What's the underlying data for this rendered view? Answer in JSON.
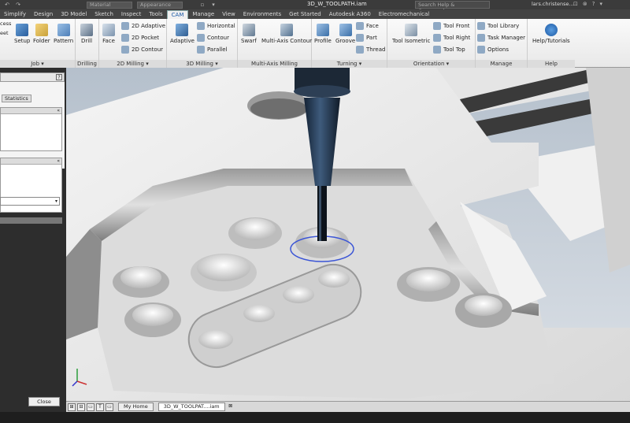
{
  "titlebar": {
    "qa_icons": [
      "↶",
      "↷",
      "▫",
      "▾"
    ],
    "material_combo": "Material",
    "appearance_combo": "Appearance",
    "document_title": "3D_W_TOOLPATH.iam",
    "search_placeholder": "Search Help & Commands...",
    "user_name": "lars.christense...",
    "right_icons": [
      "⊡",
      "⊗",
      "?",
      "▾"
    ]
  },
  "tabs": [
    "Simplify",
    "Design",
    "3D Model",
    "Sketch",
    "Inspect",
    "Tools",
    "CAM",
    "Manage",
    "View",
    "Environments",
    "Get Started",
    "Autodesk A360",
    "Electromechanical"
  ],
  "active_tab": "CAM",
  "ribbon": {
    "groups": [
      {
        "label": "Job ▾",
        "buttons": [
          "Setup",
          "Folder",
          "Pattern"
        ],
        "partial": "eet",
        "partial2": "cess"
      },
      {
        "label": "Drilling",
        "buttons": [
          "Drill"
        ]
      },
      {
        "label": "2D Milling ▾",
        "buttons": [
          "Face"
        ],
        "small": [
          "2D Adaptive",
          "2D Pocket",
          "2D Contour"
        ]
      },
      {
        "label": "3D Milling ▾",
        "buttons": [
          "Adaptive"
        ],
        "small": [
          "Horizontal",
          "Contour",
          "Parallel"
        ]
      },
      {
        "label": "Multi-Axis Milling",
        "buttons": [
          "Swarf",
          "Multi-Axis Contour"
        ]
      },
      {
        "label": "Turning ▾",
        "buttons": [
          "Profile",
          "Groove"
        ],
        "small": [
          "Face",
          "Part",
          "Thread"
        ]
      },
      {
        "label": "Orientation ▾",
        "buttons": [
          "Tool Isometric"
        ],
        "small": [
          "Tool Front",
          "Tool Right",
          "Tool Top"
        ]
      },
      {
        "label": "Manage",
        "small": [
          "Tool Library",
          "Task Manager",
          "Options"
        ]
      },
      {
        "label": "Help",
        "buttons": [
          "Help/Tutorials"
        ]
      }
    ]
  },
  "left_panel": {
    "help_glyph": "?",
    "statistics_tab": "Statistics",
    "collapse_glyph": "«",
    "dropdown_glyph": "▾",
    "close_button": "Close"
  },
  "status_bar": {
    "icons": [
      "⊞",
      "⊟",
      "▭",
      "T",
      "▭"
    ],
    "tabs": [
      "My Home",
      "3D_W_TOOLPAT....iam"
    ],
    "tab_close": "⊠"
  },
  "colors": {
    "ribbon_bg": "#f2f2f2",
    "active_tab": "#1a5aa8",
    "part": "#e9e9e9",
    "tool_body": "#2a3f5a",
    "sky": "#c7cfd8"
  }
}
